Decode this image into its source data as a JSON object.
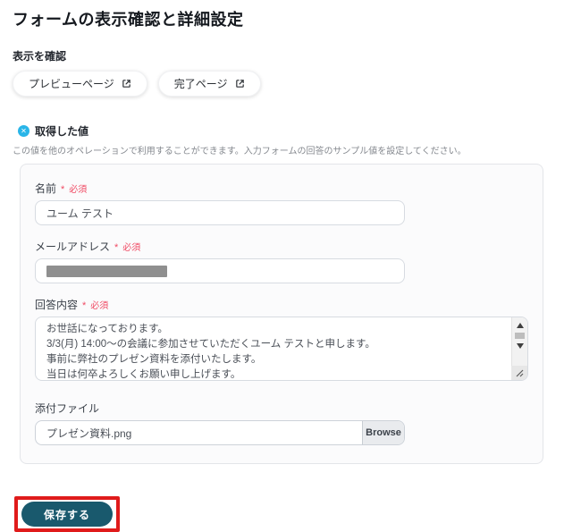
{
  "title": "フォームの表示確認と詳細設定",
  "preview": {
    "heading": "表示を確認",
    "preview_button": "プレビューページ",
    "done_button": "完了ページ"
  },
  "values": {
    "heading": "取得した値",
    "description": "この値を他のオペレーションで利用することができます。入力フォームの回答のサンプル値を設定してください。"
  },
  "form": {
    "required_mark": "*",
    "required_text": "必須",
    "name": {
      "label": "名前",
      "value": "ユーム テスト"
    },
    "email": {
      "label": "メールアドレス",
      "redacted": true
    },
    "message": {
      "label": "回答内容",
      "lines": [
        "お世話になっております。",
        "3/3(月) 14:00〜の会議に参加させていただくユーム テストと申します。",
        "事前に弊社のプレゼン資料を添付いたします。",
        "当日は何卒よろしくお願い申し上げます。"
      ]
    },
    "attachment": {
      "label": "添付ファイル",
      "value": "プレゼン資料.png",
      "browse": "Browse"
    }
  },
  "actions": {
    "save": "保存する"
  },
  "colors": {
    "accent_teal": "#19596d",
    "required_red": "#f04a63",
    "highlight_red": "#e01b1b",
    "badge_cyan": "#29b5e8"
  }
}
